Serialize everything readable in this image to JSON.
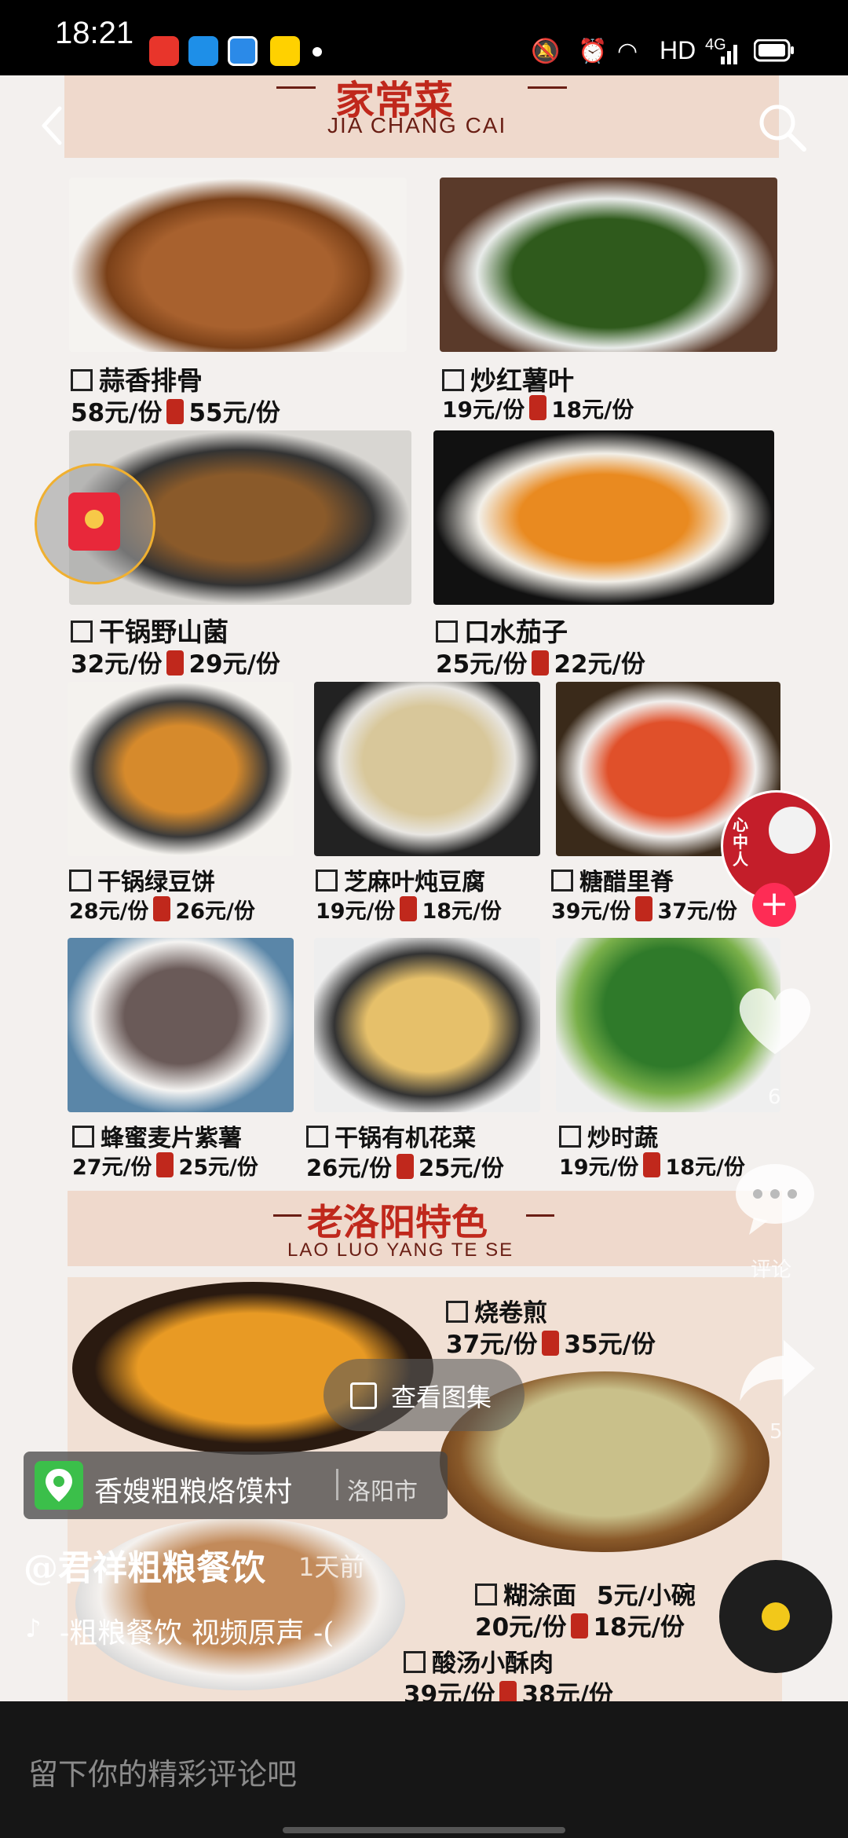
{
  "status_bar": {
    "time": "18:21",
    "network": "HD",
    "signal_label": "4G"
  },
  "nav": {
    "back_icon": "back-arrow-icon",
    "search_icon": "search-icon"
  },
  "menu": {
    "section1": {
      "title": "家常菜",
      "subtitle": "JIA CHANG CAI"
    },
    "dishes1": [
      {
        "name": "蒜香排骨",
        "price": "58元/份",
        "vip_price": "55元/份"
      },
      {
        "name": "炒红薯叶",
        "price": "19元/份",
        "vip_price": "18元/份"
      },
      {
        "name": "干锅野山菌",
        "price": "32元/份",
        "vip_price": "29元/份"
      },
      {
        "name": "口水茄子",
        "price": "25元/份",
        "vip_price": "22元/份"
      },
      {
        "name": "干锅绿豆饼",
        "price": "28元/份",
        "vip_price": "26元/份"
      },
      {
        "name": "芝麻叶炖豆腐",
        "price": "19元/份",
        "vip_price": "18元/份"
      },
      {
        "name": "糖醋里脊",
        "price": "39元/份",
        "vip_price": "37元/份"
      },
      {
        "name": "蜂蜜麦片紫薯",
        "price": "27元/份",
        "vip_price": "25元/份"
      },
      {
        "name": "干锅有机花菜",
        "price": "26元/份",
        "vip_price": "25元/份"
      },
      {
        "name": "炒时蔬",
        "price": "19元/份",
        "vip_price": "18元/份"
      }
    ],
    "section2": {
      "title": "老洛阳特色",
      "subtitle": "LAO LUO YANG TE SE"
    },
    "dishes2": [
      {
        "name": "烧卷煎",
        "price": "37元/份",
        "vip_price": "35元/份"
      },
      {
        "name": "糊涂面",
        "extra": "5元/小碗",
        "price": "20元/份",
        "vip_price": "18元/份"
      },
      {
        "name": "酸汤小酥肉",
        "price": "39元/份",
        "vip_price": "38元/份"
      }
    ]
  },
  "overlay": {
    "gallery_button": "查看图集",
    "location_name": "香嫂粗粮烙馍村",
    "location_city": "洛阳市",
    "author": "@君祥粗粮餐饮",
    "time_ago": "1天前",
    "music": "-粗粮餐饮  视频原声 -(",
    "like_count": "6",
    "comment_label": "评论",
    "share_count": "5",
    "avatar_text": "心中人"
  },
  "comment_input": {
    "placeholder": "留下你的精彩评论吧"
  },
  "colors": {
    "accent_red": "#c0281c",
    "overlay_red": "#fe2c55",
    "menu_bg": "#f3f0ee"
  }
}
